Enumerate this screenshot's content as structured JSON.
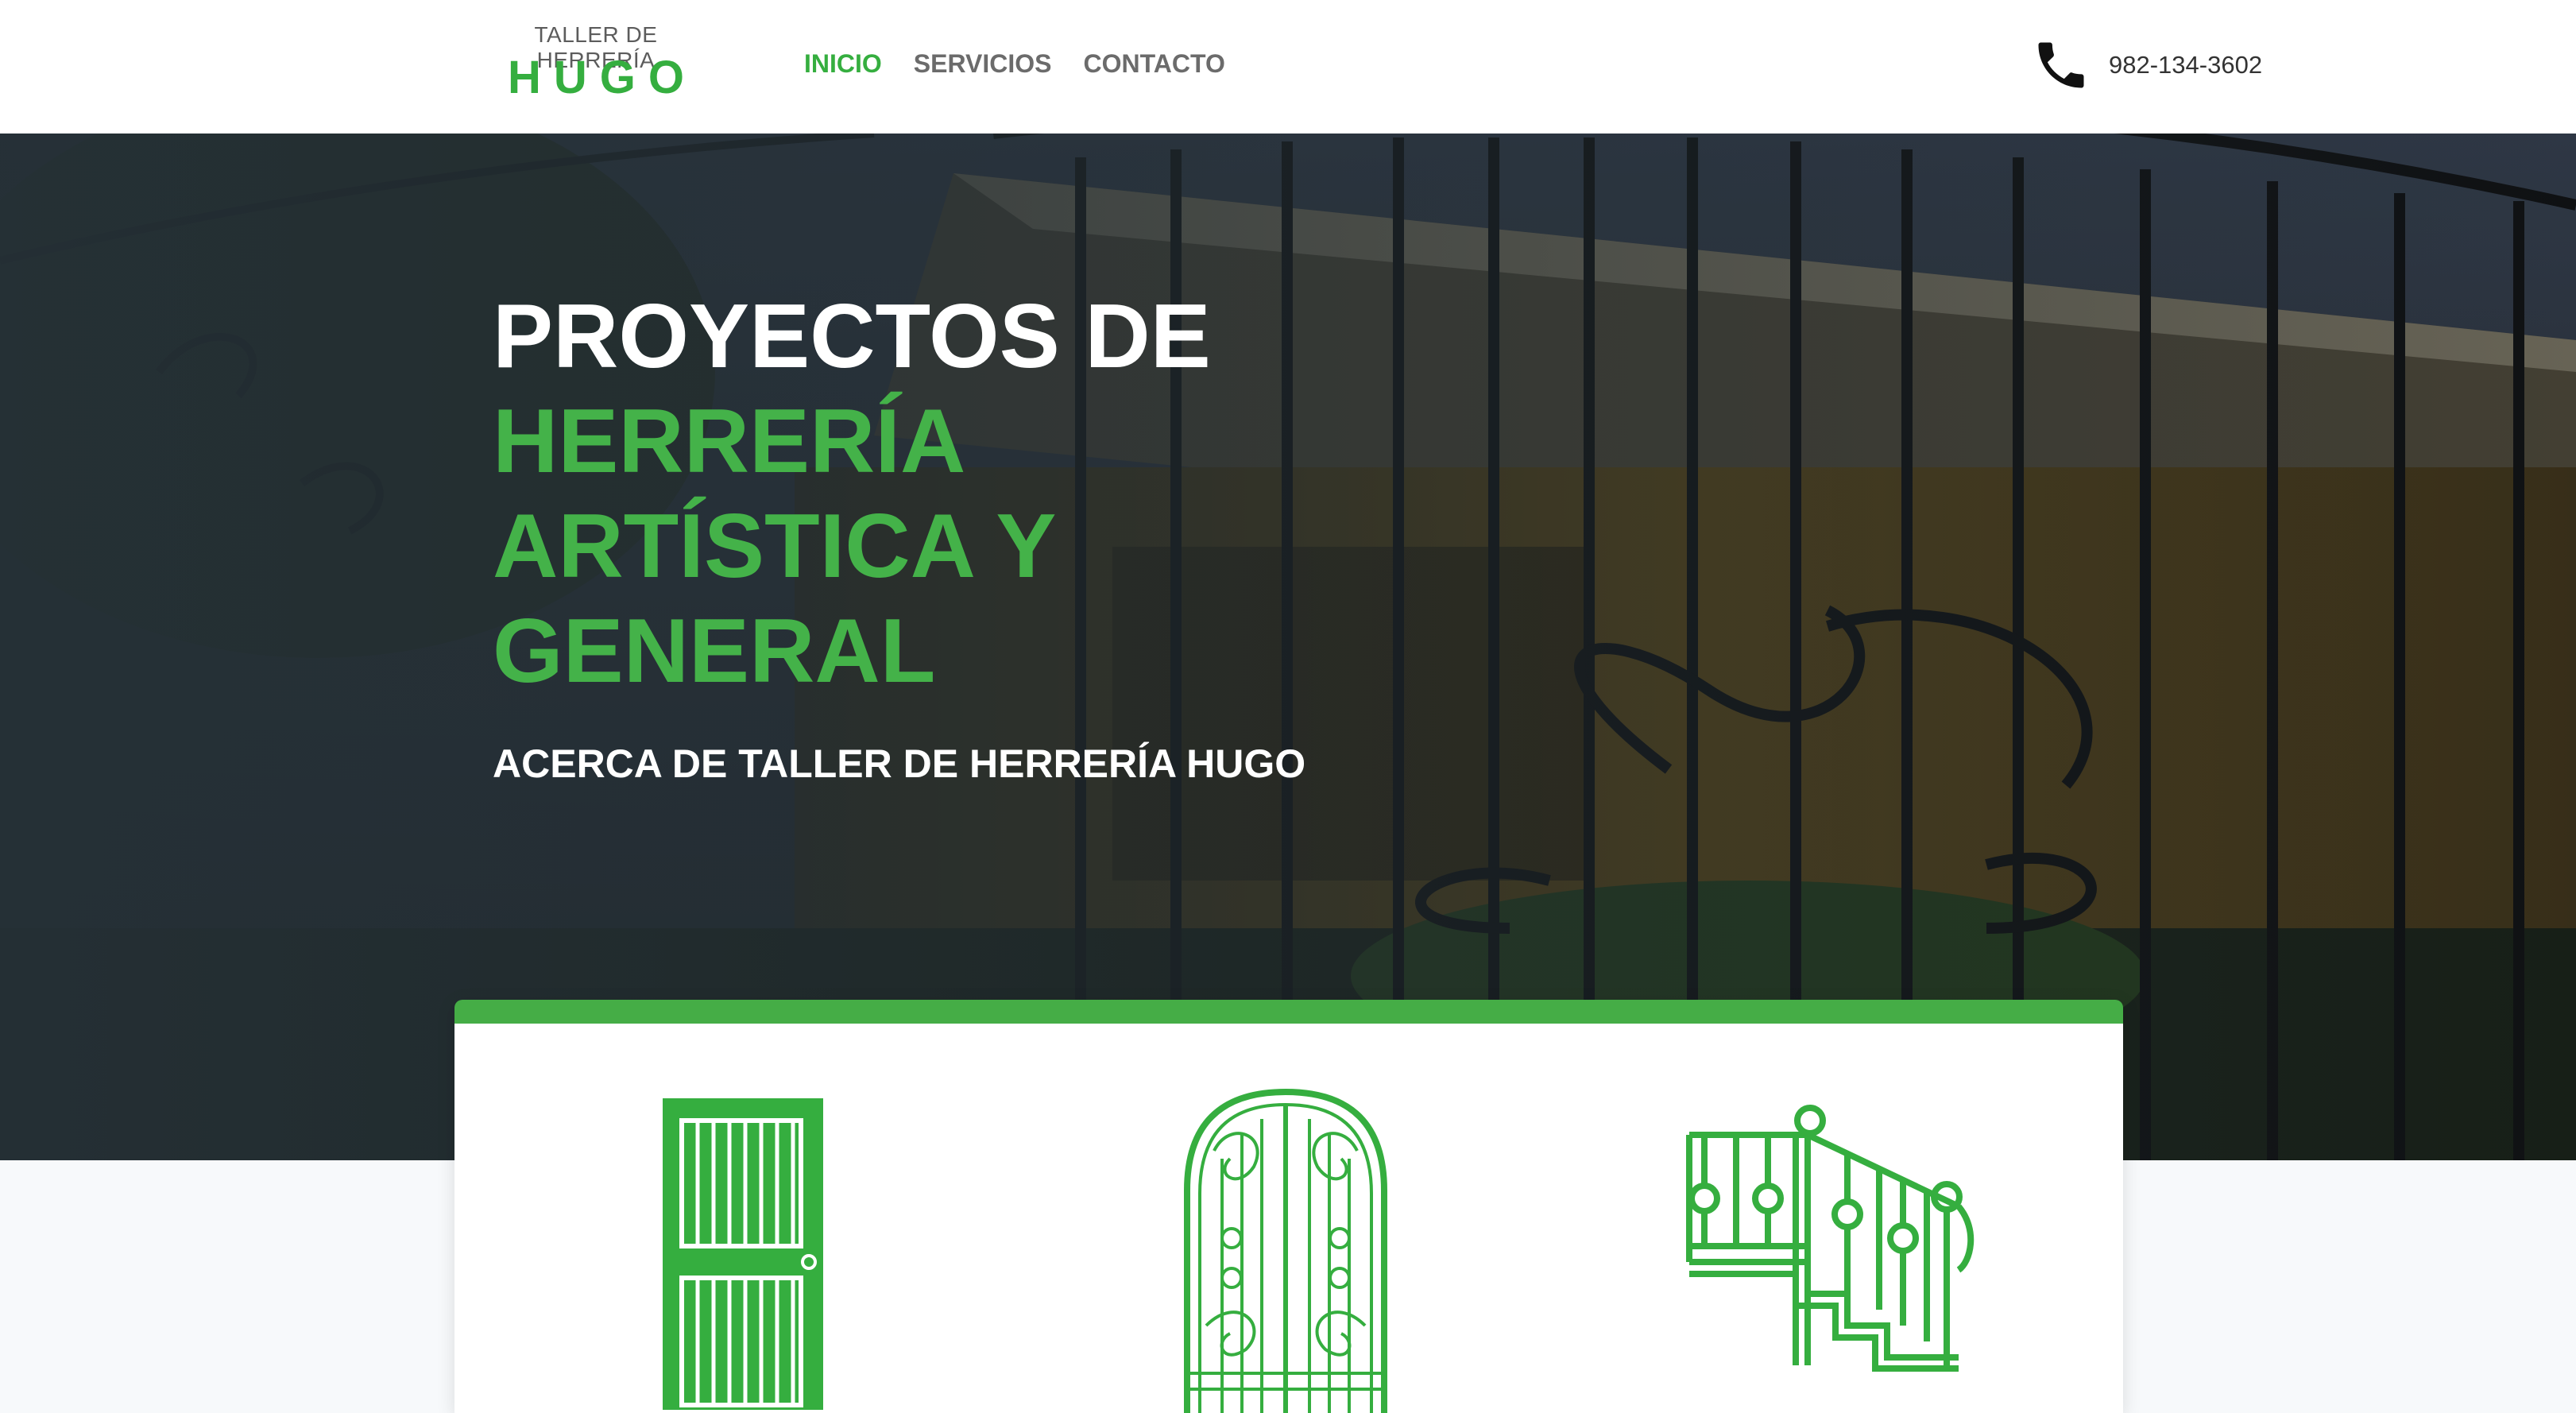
{
  "header": {
    "logo_top": "TALLER DE HERRERÍA",
    "logo_main": "HUGO",
    "nav": [
      {
        "label": "INICIO",
        "active": true
      },
      {
        "label": "SERVICIOS",
        "active": false
      },
      {
        "label": "CONTACTO",
        "active": false
      }
    ],
    "phone_icon": "phone-icon",
    "phone_number": "982-134-3602"
  },
  "hero": {
    "title_line1": "PROYECTOS DE",
    "title_line2": "HERRERÍA",
    "title_line3": "ARTÍSTICA Y",
    "title_line4": "GENERAL",
    "subtitle": "ACERCA DE TALLER DE HERRERÍA HUGO"
  },
  "services": {
    "icons": [
      "door-icon",
      "ornamental-gate-icon",
      "stair-railing-icon"
    ]
  },
  "colors": {
    "accent": "#35ae3f",
    "card_bar": "#45ad46",
    "nav_text": "#6b6b6b"
  }
}
